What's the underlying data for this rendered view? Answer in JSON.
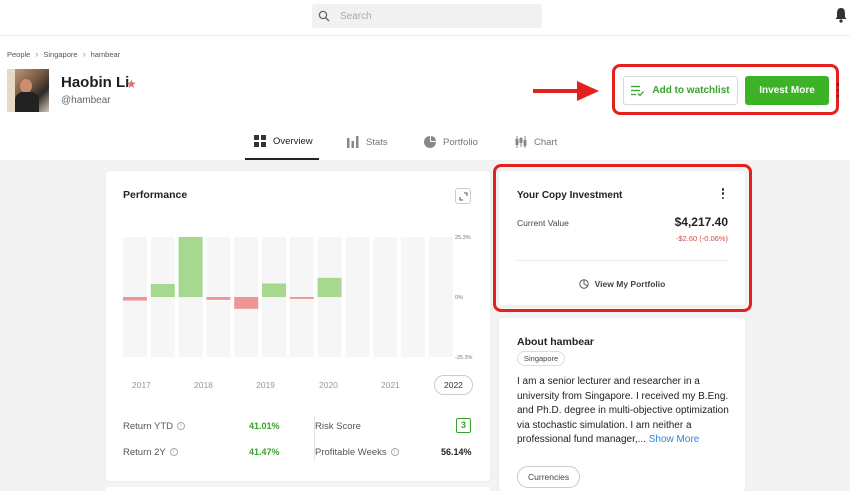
{
  "search": {
    "placeholder": "Search"
  },
  "breadcrumb": [
    "People",
    "Singapore",
    "hambear"
  ],
  "profile": {
    "name": "Haobin Li",
    "handle": "@hambear"
  },
  "actions": {
    "watchlist_label": "Add to watchlist",
    "invest_label": "Invest More"
  },
  "tabs": [
    {
      "label": "Overview",
      "icon": "grid-icon",
      "active": true
    },
    {
      "label": "Stats",
      "icon": "bar-chart-icon",
      "active": false
    },
    {
      "label": "Portfolio",
      "icon": "pie-chart-icon",
      "active": false
    },
    {
      "label": "Chart",
      "icon": "candles-icon",
      "active": false
    }
  ],
  "performance": {
    "title": "Performance",
    "years": [
      "2017",
      "2018",
      "2019",
      "2020",
      "2021",
      "2022"
    ],
    "active_year": "2022",
    "stats": {
      "return_ytd_label": "Return YTD",
      "return_ytd": "41.01%",
      "return_2y_label": "Return 2Y",
      "return_2y": "41.47%",
      "risk_score_label": "Risk Score",
      "risk_score": "3",
      "profitable_weeks_label": "Profitable Weeks",
      "profitable_weeks": "56.14%"
    }
  },
  "chart_data": {
    "type": "bar",
    "categories": [
      "1",
      "2",
      "3",
      "4",
      "5",
      "6",
      "7",
      "8",
      "9",
      "10",
      "11",
      "12"
    ],
    "values": [
      -1.5,
      5.5,
      25.3,
      -1.2,
      -5,
      5.7,
      -0.8,
      8.1,
      0,
      0,
      0,
      0
    ],
    "tick_labels": [
      "25.3%",
      "0%",
      "-25.3%"
    ],
    "ylim": [
      -25.3,
      25.3
    ],
    "colors": {
      "positive": "#a6d98f",
      "negative": "#ee9696",
      "placeholder": "#f6f6f6"
    }
  },
  "copy_investment": {
    "title": "Your Copy Investment",
    "current_value_label": "Current Value",
    "current_value": "$4,217.40",
    "change": "-$2.60  (-0.06%)",
    "view_portfolio_label": "View My Portfolio"
  },
  "about": {
    "title": "About hambear",
    "tag": "Singapore",
    "bio": "I am a senior lecturer and researcher in a university from Singapore. I received my B.Eng. and Ph.D. degree in multi-objective optimization via stochastic simulation. I am neither a professional fund manager,...",
    "show_more": "Show More",
    "currencies_label": "Currencies"
  },
  "colors": {
    "accent_green": "#3cb226",
    "highlight_red": "#e3201b",
    "link_blue": "#2e86d6"
  }
}
